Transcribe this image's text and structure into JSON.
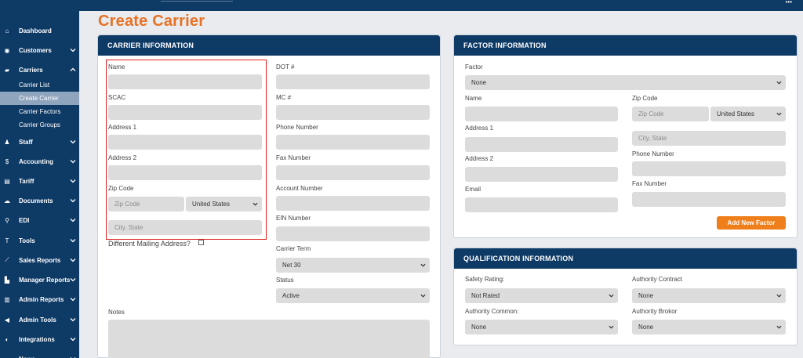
{
  "page_title": "Create Carrier",
  "topbar": {
    "dots": "•••"
  },
  "sidebar": {
    "items": [
      {
        "label": "Dashboard",
        "icon": "home-icon",
        "glyph": "⌂",
        "chevron": false
      },
      {
        "label": "Customers",
        "icon": "eye-icon",
        "glyph": "◉",
        "chevron": true
      },
      {
        "label": "Carriers",
        "icon": "truck-icon",
        "glyph": "▰",
        "chevron": true,
        "open": true
      },
      {
        "label": "Staff",
        "icon": "users-icon",
        "glyph": "♟",
        "chevron": true
      },
      {
        "label": "Accounting",
        "icon": "dollar-icon",
        "glyph": "$",
        "chevron": true
      },
      {
        "label": "Tariff",
        "icon": "file-icon",
        "glyph": "▤",
        "chevron": true
      },
      {
        "label": "Documents",
        "icon": "cloud-icon",
        "glyph": "☁",
        "chevron": true
      },
      {
        "label": "EDI",
        "icon": "network-icon",
        "glyph": "⚲",
        "chevron": true
      },
      {
        "label": "Tools",
        "icon": "tools-icon",
        "glyph": "T",
        "chevron": true
      },
      {
        "label": "Sales Reports",
        "icon": "line-chart-icon",
        "glyph": "⟋",
        "chevron": true
      },
      {
        "label": "Manager Reports",
        "icon": "area-chart-icon",
        "glyph": "▙",
        "chevron": true
      },
      {
        "label": "Admin Reports",
        "icon": "bar-chart-icon",
        "glyph": "▥",
        "chevron": true
      },
      {
        "label": "Admin Tools",
        "icon": "megaphone-icon",
        "glyph": "◀",
        "chevron": true
      },
      {
        "label": "Integrations",
        "icon": "toggle-icon",
        "glyph": "◐",
        "chevron": true
      },
      {
        "label": "News",
        "icon": "news-icon",
        "glyph": "▬",
        "chevron": true
      }
    ],
    "carrier_sub": [
      "Carrier List",
      "Create Carrier",
      "Carrier Factors",
      "Carrier Groups"
    ]
  },
  "carrier_info": {
    "title": "CARRIER INFORMATION",
    "name_label": "Name",
    "scac_label": "SCAC",
    "address1_label": "Address 1",
    "address2_label": "Address 2",
    "zip_label": "Zip Code",
    "zip_placeholder": "Zip Code",
    "country_value": "United States",
    "city_placeholder": "City, State",
    "diff_mailing_label": "Different Mailing Address?",
    "dot_label": "DOT #",
    "mc_label": "MC #",
    "phone_label": "Phone Number",
    "fax_label": "Fax Number",
    "account_label": "Account Number",
    "ein_label": "EIN Number",
    "carrier_term_label": "Carrier Term",
    "carrier_term_value": "Net 30",
    "status_label": "Status",
    "status_value": "Active",
    "notes_label": "Notes"
  },
  "factor_info": {
    "title": "FACTOR INFORMATION",
    "factor_label": "Factor",
    "factor_value": "None",
    "name_label": "Name",
    "address1_label": "Address 1",
    "address2_label": "Address 2",
    "email_label": "Email",
    "zip_label": "Zip Code",
    "zip_placeholder": "Zip Code",
    "country_value": "United States",
    "city_placeholder": "City, State",
    "phone_label": "Phone Number",
    "fax_label": "Fax Number",
    "add_button": "Add New Factor"
  },
  "qualification_info": {
    "title": "QUALIFICATION INFORMATION",
    "safety_label": "Safety Rating:",
    "safety_value": "Not Rated",
    "authority_contract_label": "Authority Contract",
    "authority_contract_value": "None",
    "authority_common_label": "Authority Common:",
    "authority_common_value": "None",
    "authority_broker_label": "Authority Brokor",
    "authority_broker_value": "None"
  },
  "colors": {
    "navy": "#0e3a66",
    "accent": "#e77225",
    "button": "#ef7f1a",
    "highlight": "#e02020"
  }
}
